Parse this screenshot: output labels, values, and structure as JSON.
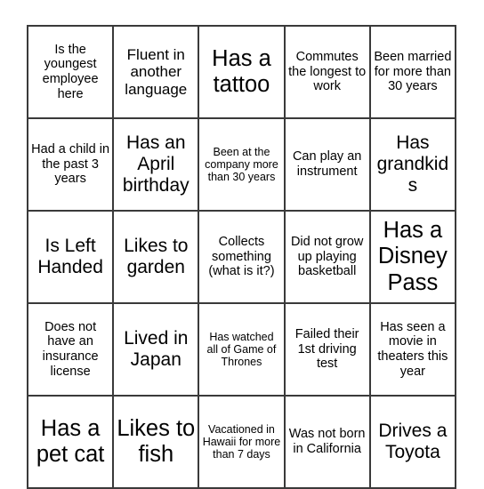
{
  "card": {
    "type": "bingo-card",
    "columns": 5,
    "rows": 5,
    "border_color": "#3a3a3a",
    "text_color": "#000000",
    "background_color": "#ffffff",
    "cells": [
      [
        {
          "text": "Is the youngest employee here",
          "size": "sm"
        },
        {
          "text": "Fluent in another language",
          "size": "md"
        },
        {
          "text": "Has a tattoo",
          "size": "xl"
        },
        {
          "text": "Commutes the longest to work",
          "size": "sm"
        },
        {
          "text": "Been married for more than 30 years",
          "size": "sm"
        }
      ],
      [
        {
          "text": "Had a child in the past 3 years",
          "size": "sm"
        },
        {
          "text": "Has an April birthday",
          "size": "lg"
        },
        {
          "text": "Been at the company more than 30 years",
          "size": "xs"
        },
        {
          "text": "Can play an instrument",
          "size": "sm"
        },
        {
          "text": "Has grandkids",
          "size": "lg"
        }
      ],
      [
        {
          "text": "Is Left Handed",
          "size": "lg"
        },
        {
          "text": "Likes to garden",
          "size": "lg"
        },
        {
          "text": "Collects something (what is it?)",
          "size": "sm"
        },
        {
          "text": "Did not grow up playing basketball",
          "size": "sm"
        },
        {
          "text": "Has a Disney Pass",
          "size": "xl"
        }
      ],
      [
        {
          "text": "Does not have an insurance license",
          "size": "sm"
        },
        {
          "text": "Lived in Japan",
          "size": "lg"
        },
        {
          "text": "Has watched all of Game of Thrones",
          "size": "xs"
        },
        {
          "text": "Failed their 1st driving test",
          "size": "sm"
        },
        {
          "text": "Has seen a movie in theaters this year",
          "size": "sm"
        }
      ],
      [
        {
          "text": "Has a pet cat",
          "size": "xl"
        },
        {
          "text": "Likes to fish",
          "size": "xl"
        },
        {
          "text": "Vacationed in Hawaii for more than 7 days",
          "size": "xs"
        },
        {
          "text": "Was not born in California",
          "size": "sm"
        },
        {
          "text": "Drives a Toyota",
          "size": "lg"
        }
      ]
    ]
  }
}
